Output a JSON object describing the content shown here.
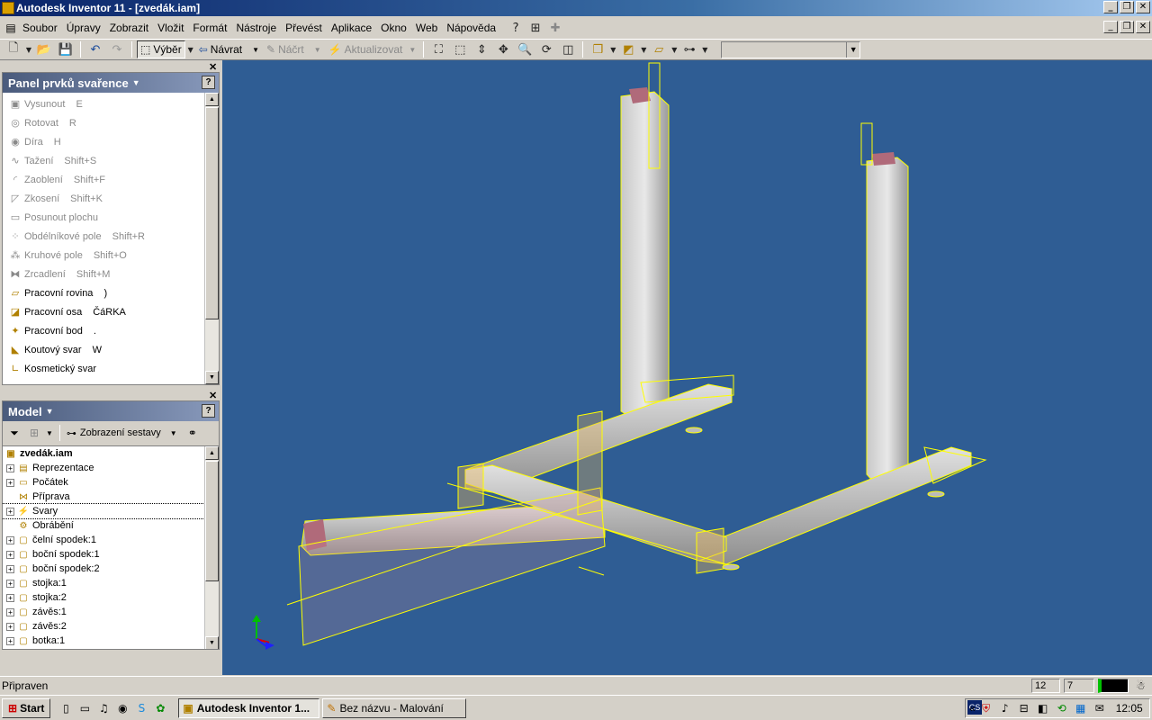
{
  "window": {
    "title": "Autodesk Inventor 11 - [zvedák.iam]"
  },
  "menu": [
    "Soubor",
    "Úpravy",
    "Zobrazit",
    "Vložit",
    "Formát",
    "Nástroje",
    "Převést",
    "Aplikace",
    "Okno",
    "Web",
    "Nápověda"
  ],
  "toolbar": {
    "select_label": "Výběr",
    "return_label": "Návrat",
    "sketch_label": "Náčrt",
    "update_label": "Aktualizovat",
    "combo_value": ""
  },
  "feature_panel": {
    "title": "Panel prvků svařence",
    "items": [
      {
        "label": "Vysunout",
        "shortcut": "E",
        "icon": "extrude-icon",
        "enabled": false
      },
      {
        "label": "Rotovat",
        "shortcut": "R",
        "icon": "revolve-icon",
        "enabled": false
      },
      {
        "label": "Díra",
        "shortcut": "H",
        "icon": "hole-icon",
        "enabled": false
      },
      {
        "label": "Tažení",
        "shortcut": "Shift+S",
        "icon": "sweep-icon",
        "enabled": false
      },
      {
        "label": "Zaoblení",
        "shortcut": "Shift+F",
        "icon": "fillet-icon",
        "enabled": false
      },
      {
        "label": "Zkosení",
        "shortcut": "Shift+K",
        "icon": "chamfer-icon",
        "enabled": false
      },
      {
        "label": "Posunout plochu",
        "shortcut": "",
        "icon": "move-face-icon",
        "enabled": false
      },
      {
        "label": "Obdélníkové pole",
        "shortcut": "Shift+R",
        "icon": "rect-pattern-icon",
        "enabled": false
      },
      {
        "label": "Kruhové pole",
        "shortcut": "Shift+O",
        "icon": "circular-pattern-icon",
        "enabled": false
      },
      {
        "label": "Zrcadlení",
        "shortcut": "Shift+M",
        "icon": "mirror-icon",
        "enabled": false
      },
      {
        "label": "Pracovní rovina",
        "shortcut": ")",
        "icon": "work-plane-icon",
        "enabled": true
      },
      {
        "label": "Pracovní osa",
        "shortcut": "ČáRKA",
        "icon": "work-axis-icon",
        "enabled": true
      },
      {
        "label": "Pracovní bod",
        "shortcut": ".",
        "icon": "work-point-icon",
        "enabled": true
      },
      {
        "label": "Koutový svar",
        "shortcut": "W",
        "icon": "fillet-weld-icon",
        "enabled": true
      },
      {
        "label": "Kosmetický svar",
        "shortcut": "",
        "icon": "cosmetic-weld-icon",
        "enabled": true
      }
    ]
  },
  "model_panel": {
    "title": "Model",
    "view_label": "Zobrazení sestavy",
    "root": "zvedák.iam",
    "items": [
      {
        "label": "Reprezentace",
        "icon": "representation-icon",
        "expandable": true,
        "selected": false
      },
      {
        "label": "Počátek",
        "icon": "folder-icon",
        "expandable": true,
        "selected": false
      },
      {
        "label": "Příprava",
        "icon": "preparation-icon",
        "expandable": false,
        "selected": false
      },
      {
        "label": "Svary",
        "icon": "weld-icon",
        "expandable": true,
        "selected": true
      },
      {
        "label": "Obrábění",
        "icon": "machining-icon",
        "expandable": false,
        "selected": false
      },
      {
        "label": "čelní spodek:1",
        "icon": "part-icon",
        "expandable": true,
        "selected": false
      },
      {
        "label": "boční spodek:1",
        "icon": "part-icon",
        "expandable": true,
        "selected": false
      },
      {
        "label": "boční spodek:2",
        "icon": "part-icon",
        "expandable": true,
        "selected": false
      },
      {
        "label": "stojka:1",
        "icon": "part-icon",
        "expandable": true,
        "selected": false
      },
      {
        "label": "stojka:2",
        "icon": "part-icon",
        "expandable": true,
        "selected": false
      },
      {
        "label": "závěs:1",
        "icon": "part-icon",
        "expandable": true,
        "selected": false
      },
      {
        "label": "závěs:2",
        "icon": "part-icon",
        "expandable": true,
        "selected": false
      },
      {
        "label": "botka:1",
        "icon": "part-icon",
        "expandable": true,
        "selected": false
      }
    ]
  },
  "status": {
    "text": "Připraven",
    "count1": "12",
    "count2": "7"
  },
  "taskbar": {
    "start": "Start",
    "tasks": [
      {
        "label": "Autodesk Inventor 1...",
        "active": true
      },
      {
        "label": "Bez názvu - Malování",
        "active": false
      }
    ],
    "lang": "CS",
    "clock": "12:05"
  },
  "colors": {
    "viewport": "#2f5d94",
    "accent": "#0a246a",
    "edge": "#ffff00"
  }
}
